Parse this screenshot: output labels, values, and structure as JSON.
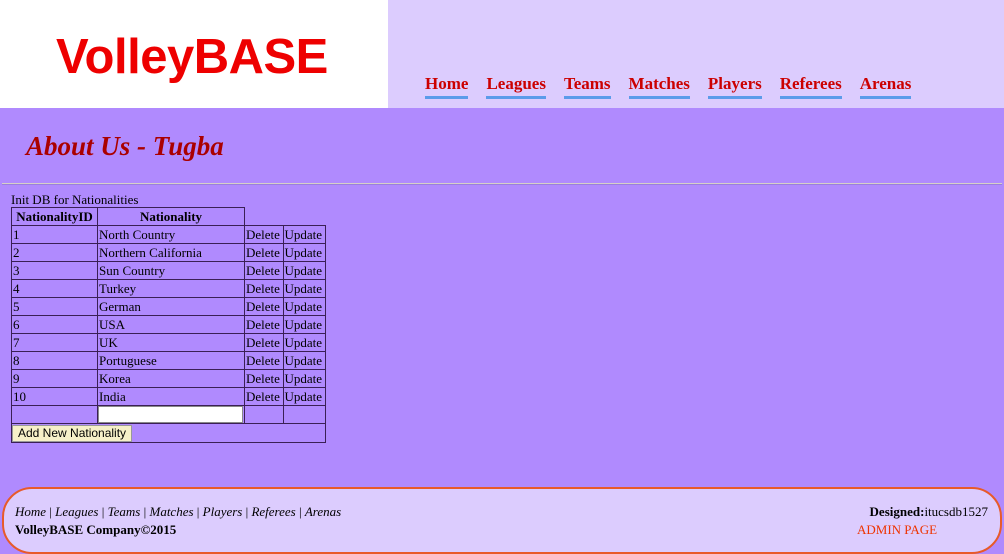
{
  "header": {
    "logo": "VolleyBASE",
    "nav": [
      "Home",
      "Leagues",
      "Teams",
      "Matches",
      "Players",
      "Referees",
      "Arenas"
    ]
  },
  "page_title": "About Us - Tugba",
  "init_label": "Init DB for Nationalities",
  "table": {
    "headers": [
      "NationalityID",
      "Nationality"
    ],
    "delete_label": "Delete",
    "update_label": "Update",
    "rows": [
      {
        "id": "1",
        "name": "North Country"
      },
      {
        "id": "2",
        "name": "Northern California"
      },
      {
        "id": "3",
        "name": "Sun Country"
      },
      {
        "id": "4",
        "name": "Turkey"
      },
      {
        "id": "5",
        "name": "German"
      },
      {
        "id": "6",
        "name": "USA"
      },
      {
        "id": "7",
        "name": "UK"
      },
      {
        "id": "8",
        "name": "Portuguese"
      },
      {
        "id": "9",
        "name": "Korea"
      },
      {
        "id": "10",
        "name": "India"
      }
    ],
    "new_value": "",
    "add_button": "Add New Nationality"
  },
  "footer": {
    "links": [
      "Home",
      "Leagues",
      "Teams",
      "Matches",
      "Players",
      "Referees",
      "Arenas"
    ],
    "separator": " | ",
    "company": "VolleyBASE Company©2015",
    "designed_label": "Designed:",
    "designed_value": "itucsdb1527",
    "admin_link": "ADMIN PAGE"
  },
  "colors": {
    "background": "#b08afe",
    "header_nav_bg": "#dcccfe",
    "logo": "#ee0000",
    "link": "#cc0000",
    "footer_border": "#e85a2a"
  }
}
